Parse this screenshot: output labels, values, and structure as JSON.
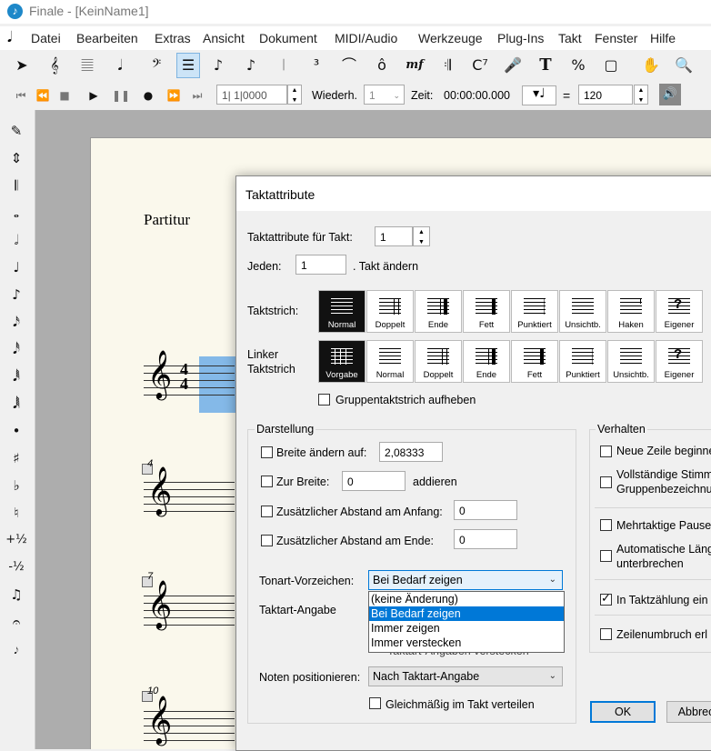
{
  "app": {
    "title": "Finale  - [KeinName1]"
  },
  "menu": [
    "Datei",
    "Bearbeiten",
    "Extras",
    "Ansicht",
    "Dokument",
    "MIDI/Audio",
    "Werkzeuge",
    "Plug-Ins",
    "Takt",
    "Fenster",
    "Hilfe"
  ],
  "tools": [
    {
      "name": "selection-tool-icon",
      "glyph": "➤"
    },
    {
      "name": "staff-tool-icon",
      "glyph": "𝄞"
    },
    {
      "name": "simple-entry-icon",
      "glyph": "𝄚"
    },
    {
      "name": "speedy-entry-icon",
      "glyph": "𝅘𝅥"
    },
    {
      "name": "key-signature-icon",
      "glyph": "𝄢"
    },
    {
      "name": "measure-tool-icon",
      "glyph": "☰"
    },
    {
      "name": "note-icon",
      "glyph": "♪"
    },
    {
      "name": "eighth-note-icon",
      "glyph": "♪"
    },
    {
      "name": "articulation-icon",
      "glyph": "𝄀"
    },
    {
      "name": "tuplet-icon",
      "glyph": "³"
    },
    {
      "name": "smart-shape-icon",
      "glyph": "⌒"
    },
    {
      "name": "articulation-accent-icon",
      "glyph": "ô"
    },
    {
      "name": "expression-icon",
      "glyph": "mf"
    },
    {
      "name": "repeat-icon",
      "glyph": "𝄇"
    },
    {
      "name": "chord-icon",
      "glyph": "C⁷"
    },
    {
      "name": "lyrics-icon",
      "glyph": "🎤"
    },
    {
      "name": "text-tool-icon",
      "glyph": "T"
    },
    {
      "name": "resize-tool-icon",
      "glyph": "%"
    },
    {
      "name": "page-layout-icon",
      "glyph": "▢"
    },
    {
      "name": "hand-grabber-icon",
      "glyph": "✋"
    },
    {
      "name": "zoom-icon",
      "glyph": "🔍"
    }
  ],
  "transport": {
    "counter": "1| 1|0000",
    "repeat_label": "Wiederh.",
    "repeat_value": "1",
    "time_label": "Zeit:",
    "time_value": "00:00:00.000",
    "equals": "=",
    "tempo": "120"
  },
  "palette": [
    "✎",
    "⇕",
    "𝄃",
    "𝅝",
    "𝅗𝅥",
    "♩",
    "♪",
    "𝅘𝅥𝅯",
    "𝅘𝅥𝅰",
    "𝅘𝅥𝅱",
    "𝅘𝅥𝅲",
    "•",
    "♯",
    "♭",
    "♮",
    "+½",
    "-½",
    "♫",
    "𝄐",
    "𝆕"
  ],
  "score": {
    "title": "Partitur",
    "measure_numbers": [
      "4",
      "7",
      "10"
    ],
    "time_sig_top": "4",
    "time_sig_bottom": "4"
  },
  "dialog": {
    "title": "Taktattribute",
    "takt_label": "Taktattribute für Takt:",
    "takt_value": "1",
    "jeden_label": "Jeden:",
    "jeden_value": "1",
    "jeden_suffix": ". Takt ändern",
    "barline_label": "Taktstrich:",
    "barlines": [
      "Normal",
      "Doppelt",
      "Ende",
      "Fett",
      "Punktiert",
      "Unsichtb.",
      "Haken",
      "Eigener"
    ],
    "left_barline_label_1": "Linker",
    "left_barline_label_2": "Taktstrich",
    "left_barlines": [
      "Vorgabe",
      "Normal",
      "Doppelt",
      "Ende",
      "Fett",
      "Punktiert",
      "Unsichtb.",
      "Eigener"
    ],
    "group_barline": "Gruppentaktstrich aufheben",
    "darstellung": {
      "title": "Darstellung",
      "breite_label": "Breite ändern auf:",
      "breite_value": "2,08333",
      "zur_breite_label": "Zur Breite:",
      "zur_breite_value": "0",
      "zur_breite_suffix": "addieren",
      "abstand_anfang_label": "Zusätzlicher Abstand am Anfang:",
      "abstand_anfang_value": "0",
      "abstand_ende_label": "Zusätzlicher Abstand am Ende:",
      "abstand_ende_value": "0",
      "tonart_label": "Tonart-Vorzeichen:",
      "tonart_value": "Bei Bedarf zeigen",
      "tonart_options": [
        "(keine Änderung)",
        "Bei Bedarf zeigen",
        "Immer zeigen",
        "Immer verstecken"
      ],
      "taktart_label": "Taktart-Angabe",
      "taktart_hidden": "Taktart-Angaben verstecken",
      "noten_label": "Noten positionieren:",
      "noten_value": "Nach Taktart-Angabe",
      "gleich_label": "Gleichmäßig im Takt verteilen"
    },
    "verhalten": {
      "title": "Verhalten",
      "items": [
        "Neue Zeile beginnen",
        "Vollständige Stimm",
        "Gruppenbezeichnu",
        "Mehrtaktige Pause",
        "Automatische Läng",
        "unterbrechen",
        "In Taktzählung ein",
        "Zeilenumbruch erl"
      ]
    },
    "ok": "OK",
    "cancel": "Abbrech"
  }
}
